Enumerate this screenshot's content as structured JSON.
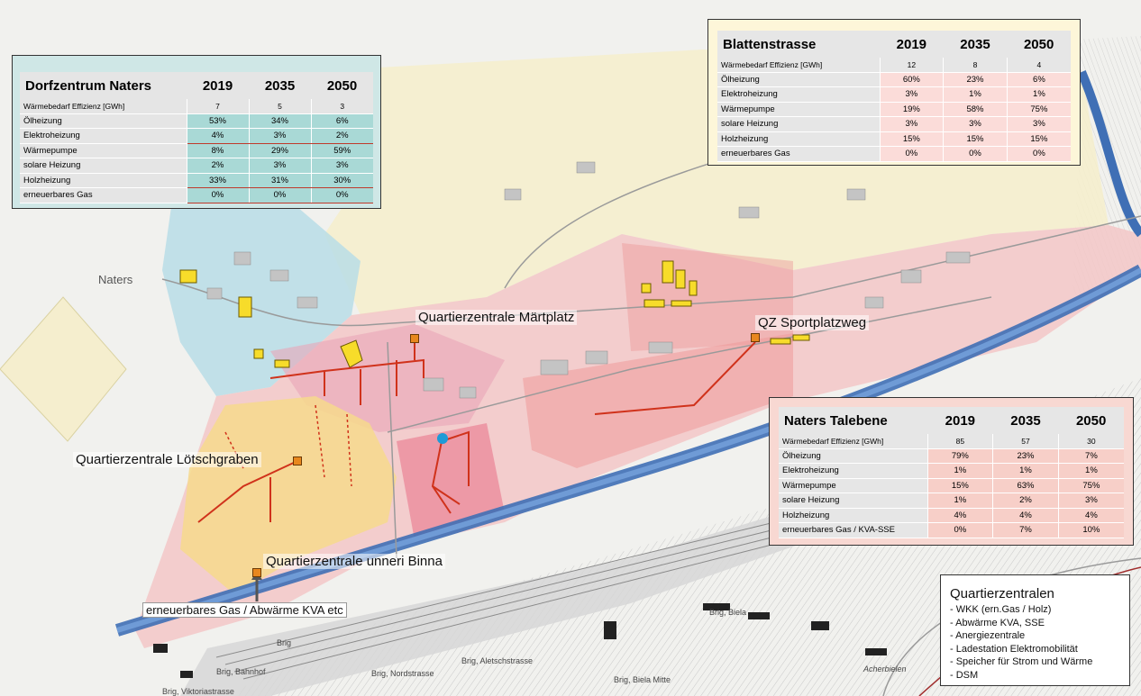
{
  "panels": {
    "dorfzentrum": {
      "title": "Dorfzentrum Naters",
      "years": [
        "2019",
        "2035",
        "2050"
      ],
      "rows": [
        {
          "label": "Wärmebedarf Effizienz [GWh]",
          "values": [
            "7",
            "5",
            "3"
          ]
        },
        {
          "label": "Ölheizung",
          "values": [
            "53%",
            "34%",
            "6%"
          ]
        },
        {
          "label": "Elektroheizung",
          "values": [
            "4%",
            "3%",
            "2%"
          ]
        },
        {
          "label": "Wärmepumpe",
          "values": [
            "8%",
            "29%",
            "59%"
          ]
        },
        {
          "label": "solare Heizung",
          "values": [
            "2%",
            "3%",
            "3%"
          ]
        },
        {
          "label": "Holzheizung",
          "values": [
            "33%",
            "31%",
            "30%"
          ]
        },
        {
          "label": "erneuerbares Gas",
          "values": [
            "0%",
            "0%",
            "0%"
          ]
        }
      ]
    },
    "blattenstrasse": {
      "title": "Blattenstrasse",
      "years": [
        "2019",
        "2035",
        "2050"
      ],
      "rows": [
        {
          "label": "Wärmebedarf Effizienz [GWh]",
          "values": [
            "12",
            "8",
            "4"
          ]
        },
        {
          "label": "Ölheizung",
          "values": [
            "60%",
            "23%",
            "6%"
          ]
        },
        {
          "label": "Elektroheizung",
          "values": [
            "3%",
            "1%",
            "1%"
          ]
        },
        {
          "label": "Wärmepumpe",
          "values": [
            "19%",
            "58%",
            "75%"
          ]
        },
        {
          "label": "solare Heizung",
          "values": [
            "3%",
            "3%",
            "3%"
          ]
        },
        {
          "label": "Holzheizung",
          "values": [
            "15%",
            "15%",
            "15%"
          ]
        },
        {
          "label": "erneuerbares Gas",
          "values": [
            "0%",
            "0%",
            "0%"
          ]
        }
      ]
    },
    "talebene": {
      "title": "Naters Talebene",
      "years": [
        "2019",
        "2035",
        "2050"
      ],
      "rows": [
        {
          "label": "Wärmebedarf Effizienz [GWh]",
          "values": [
            "85",
            "57",
            "30"
          ]
        },
        {
          "label": "Ölheizung",
          "values": [
            "79%",
            "23%",
            "7%"
          ]
        },
        {
          "label": "Elektroheizung",
          "values": [
            "1%",
            "1%",
            "1%"
          ]
        },
        {
          "label": "Wärmepumpe",
          "values": [
            "15%",
            "63%",
            "75%"
          ]
        },
        {
          "label": "solare Heizung",
          "values": [
            "1%",
            "2%",
            "3%"
          ]
        },
        {
          "label": "Holzheizung",
          "values": [
            "4%",
            "4%",
            "4%"
          ]
        },
        {
          "label": "erneuerbares Gas / KVA-SSE",
          "values": [
            "0%",
            "7%",
            "10%"
          ]
        }
      ]
    }
  },
  "labels": {
    "maertplatz": "Quartierzentrale Märtplatz",
    "sportplatzweg": "QZ Sportplatzweg",
    "loetschgraben": "Quartierzentrale Lötschgraben",
    "unneri_binna": "Quartierzentrale unneri Binna",
    "gas_abwaerme": "erneuerbares Gas / Abwärme KVA etc",
    "naters": "Naters"
  },
  "map_texts": {
    "brig_bahnhof": "Brig, Bahnhof",
    "brig_nordstrasse": "Brig, Nordstrasse",
    "brig_aletschstrasse": "Brig, Aletschstrasse",
    "brig_biela_mitte": "Brig, Biela Mitte",
    "brig_biela": "Brig, Biela",
    "brig_viktoriastrasse": "Brig, Viktoriastrasse",
    "brig": "Brig",
    "acherbielen": "Acherbielen"
  },
  "legend": {
    "title": "Quartierzentralen",
    "items": [
      "- WKK (ern.Gas / Holz)",
      "- Abwärme KVA, SSE",
      "- Anergiezentrale",
      "- Ladestation Elektromobilität",
      "- Speicher für Strom und Wärme",
      "- DSM"
    ]
  },
  "colors": {
    "dorfzentrum_zone": "#b9dde6",
    "blatten_zone": "#f6eecb",
    "talebene_zone": "#f3c7c7",
    "loetschgraben_zone": "#f6d98c",
    "river": "#3f6fb5",
    "network_line": "#d0321b",
    "marker": "#e8871e",
    "building_highlight": "#f7dc2a"
  }
}
